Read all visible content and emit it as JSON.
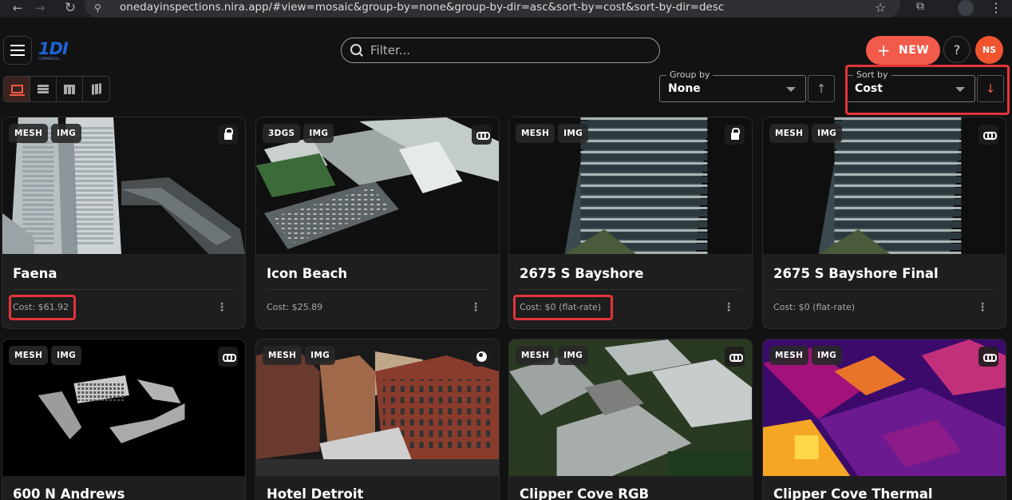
{
  "browser": {
    "url": "onedayinspections.nira.app/#view=mosaic&group-by=none&group-by-dir=asc&sort-by=cost&sort-by-dir=desc",
    "back_glyph": "←",
    "forward_glyph": "→",
    "reload_glyph": "↻",
    "site_glyph": "⚲",
    "star_glyph": "☆",
    "extensions_glyph": "⧉",
    "menu_glyph": "⋮"
  },
  "header": {
    "logo": "1DI",
    "logo_sub": "COMMERCIAL",
    "filter_placeholder": "Filter...",
    "new_plus": "+",
    "new_label": "NEW",
    "help_label": "?",
    "avatar_initials": "NS"
  },
  "controls": {
    "group_by_label": "Group by",
    "group_by_value": "None",
    "group_dir_glyph": "↑",
    "sort_by_label": "Sort by",
    "sort_by_value": "Cost",
    "sort_dir_glyph": "↓"
  },
  "cards": [
    {
      "title": "Faena",
      "tags": [
        "MESH",
        "IMG"
      ],
      "corner_icon": "lock-icon",
      "cost": "Cost: $61.92",
      "menu": "⋮"
    },
    {
      "title": "Icon Beach",
      "tags": [
        "3DGS",
        "IMG"
      ],
      "corner_icon": "link-icon",
      "cost": "Cost: $25.89",
      "menu": "⋮"
    },
    {
      "title": "2675 S Bayshore",
      "tags": [
        "MESH",
        "IMG"
      ],
      "corner_icon": "lock-icon",
      "cost": "Cost: $0 (flat-rate)",
      "menu": "⋮"
    },
    {
      "title": "2675 S Bayshore Final",
      "tags": [
        "MESH",
        "IMG"
      ],
      "corner_icon": "link-icon",
      "cost": "Cost: $0 (flat-rate)",
      "menu": "⋮"
    },
    {
      "title": "600 N Andrews",
      "tags": [
        "MESH",
        "IMG"
      ],
      "corner_icon": "link-icon"
    },
    {
      "title": "Hotel Detroit",
      "tags": [
        "MESH",
        "IMG"
      ],
      "corner_icon": "globe-icon"
    },
    {
      "title": "Clipper Cove RGB",
      "tags": [
        "MESH",
        "IMG"
      ],
      "corner_icon": "link-icon"
    },
    {
      "title": "Clipper Cove Thermal",
      "tags": [
        "MESH",
        "IMG"
      ],
      "corner_icon": "link-icon"
    }
  ],
  "colors": {
    "accent": "#f25a4a",
    "highlight": "#e3343a",
    "background": "#121212",
    "card": "#1e1e1e",
    "logo_blue": "#1e63d6"
  }
}
